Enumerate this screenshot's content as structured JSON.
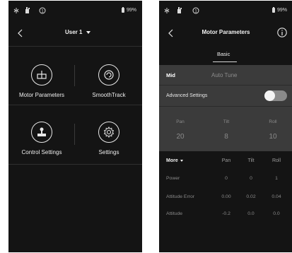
{
  "status_bar": {
    "battery": "99%",
    "icons": [
      "vibrate-icon",
      "gimbal-icon",
      "circle-1-icon",
      "battery-icon"
    ],
    "circle_badge": "1"
  },
  "left_screen": {
    "header": {
      "user_label": "User 1"
    },
    "menu": [
      {
        "label": "Motor Parameters",
        "icon": "motor-parameters-icon"
      },
      {
        "label": "SmoothTrack",
        "icon": "smoothtrack-icon"
      },
      {
        "label": "Control Settings",
        "icon": "control-settings-icon"
      },
      {
        "label": "Settings",
        "icon": "gear-icon"
      }
    ]
  },
  "right_screen": {
    "header": {
      "title": "Motor Parameters",
      "info_icon": "info-icon"
    },
    "tab": "Basic",
    "mode": {
      "current": "Mid",
      "auto_tune": "Auto Tune"
    },
    "advanced_settings": {
      "label": "Advanced Settings",
      "enabled": false
    },
    "axes": [
      {
        "name": "Pan",
        "value": "20"
      },
      {
        "name": "Tilt",
        "value": "8"
      },
      {
        "name": "Roll",
        "value": "10"
      }
    ],
    "more_table": {
      "more_label": "More",
      "columns": [
        "Pan",
        "Tilt",
        "Roll"
      ],
      "rows": [
        {
          "label": "Power",
          "values": [
            "0",
            "0",
            "1"
          ]
        },
        {
          "label": "Attitude Error",
          "values": [
            "0.00",
            "0.02",
            "0.04"
          ]
        },
        {
          "label": "Attitude",
          "values": [
            "-0.2",
            "0.0",
            "0.0"
          ]
        }
      ]
    }
  },
  "colors": {
    "screen_bg": "#141414",
    "panel_bg": "#3b3b3b",
    "text_primary": "#f0f0f0",
    "text_muted": "#8a8a8a",
    "toggle_off": "#8a8a8a"
  }
}
